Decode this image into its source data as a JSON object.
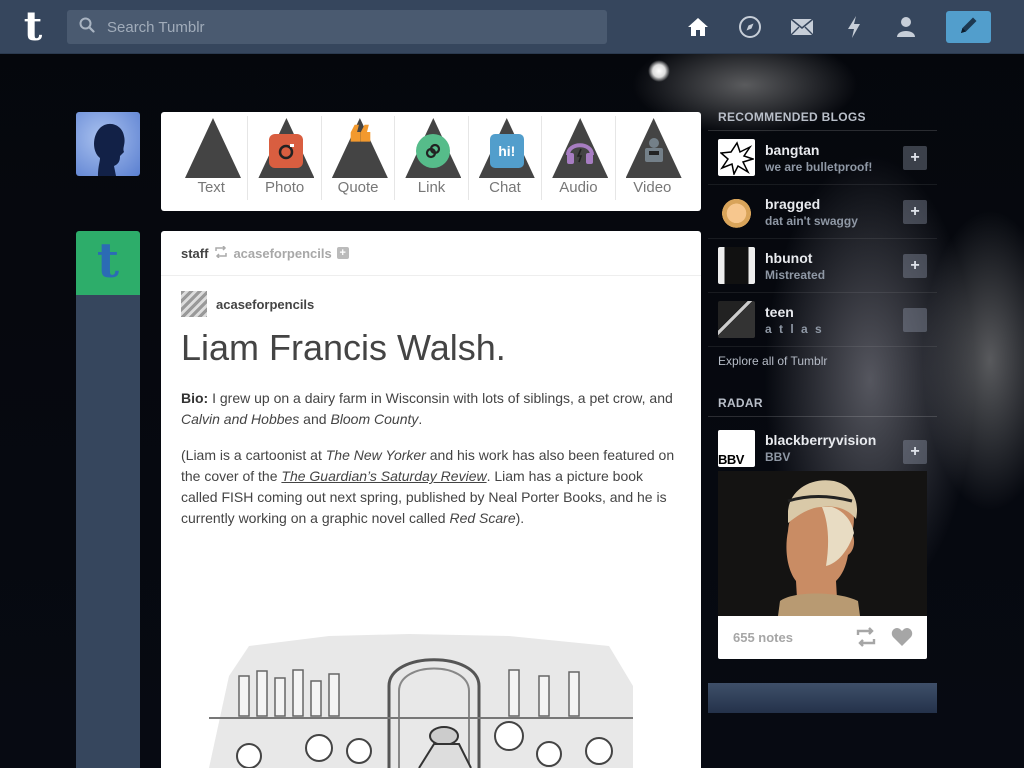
{
  "header": {
    "search_placeholder": "Search Tumblr",
    "logo_text": "t",
    "nav": [
      "home-icon",
      "explore-compass-icon",
      "inbox-mail-icon",
      "activity-lightning-icon",
      "account-person-icon"
    ],
    "compose_icon": "pencil-icon"
  },
  "colors": {
    "header_bg": "#36465d",
    "accent": "#529ecc",
    "staff_avatar_bg": "#2dad6a"
  },
  "composer": {
    "types": [
      {
        "label": "Text",
        "icon": "text-icon",
        "color": "#444444"
      },
      {
        "label": "Photo",
        "icon": "camera-icon",
        "color": "#d95e40"
      },
      {
        "label": "Quote",
        "icon": "quote-icon",
        "color": "#f2992e"
      },
      {
        "label": "Link",
        "icon": "link-icon",
        "color": "#56bc8a"
      },
      {
        "label": "Chat",
        "icon": "chat-icon",
        "color": "#529ecc"
      },
      {
        "label": "Audio",
        "icon": "headphones-icon",
        "color": "#a77dc2"
      },
      {
        "label": "Video",
        "icon": "video-camera-icon",
        "color": "#748089"
      }
    ]
  },
  "post": {
    "poster": "staff",
    "source": "acaseforpencils",
    "attribution": "acaseforpencils",
    "title": "Liam Francis Walsh.",
    "bio_label": "Bio:",
    "bio_text_1": " I grew up on a dairy farm in Wisconsin with lots of siblings, a pet crow, and ",
    "bio_italic_1": "Calvin and Hobbes",
    "bio_text_2": " and ",
    "bio_italic_2": "Bloom County",
    "bio_text_3": ".",
    "p2_text_1": "(Liam is a cartoonist at ",
    "p2_italic_1": "The New Yorker",
    "p2_text_2": " and his work has also been featured on the cover of the ",
    "p2_link": "The Guardian’s Saturday Review",
    "p2_text_3": ". Liam has a picture book called FISH coming out next spring, published by Neal Porter Books, and he is currently working on a graphic novel called ",
    "p2_italic_2": "Red Scare",
    "p2_text_4": ")."
  },
  "sidebar": {
    "recommended_title": "RECOMMENDED BLOGS",
    "blogs": [
      {
        "name": "bangtan",
        "desc": "we are bulletproof!"
      },
      {
        "name": "bragged",
        "desc": "dat ain't swaggy"
      },
      {
        "name": "hbunot",
        "desc": "Mistreated"
      },
      {
        "name": "teen",
        "desc": "a t l a s"
      }
    ],
    "explore": "Explore all of Tumblr",
    "radar_title": "RADAR",
    "radar": {
      "name": "blackberryvision",
      "desc": "BBV",
      "avatar_text": "BBV",
      "notes": "655 notes"
    }
  }
}
